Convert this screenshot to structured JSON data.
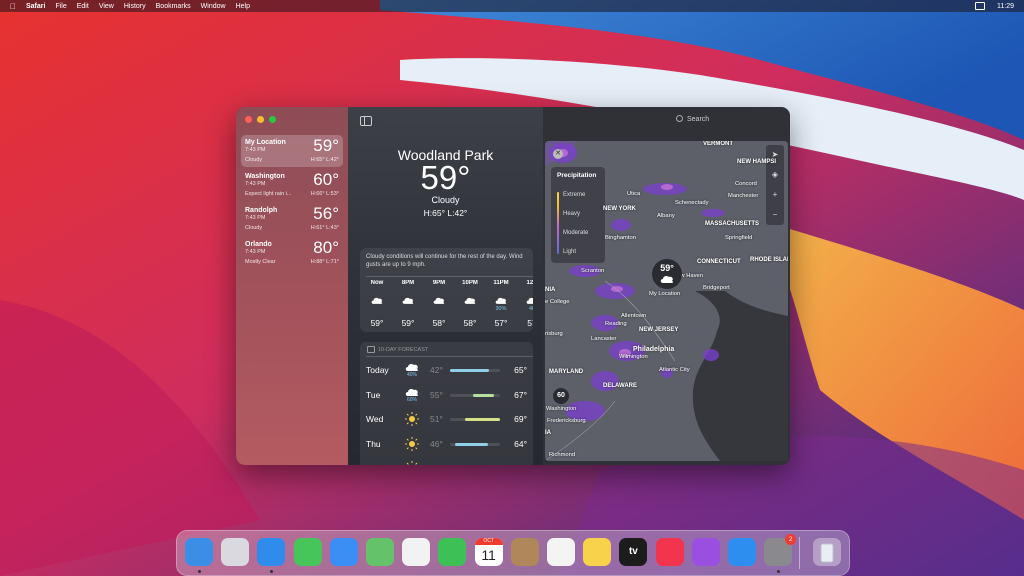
{
  "menubar": {
    "app": "Safari",
    "items": [
      "File",
      "Edit",
      "View",
      "History",
      "Bookmarks",
      "Window",
      "Help"
    ],
    "clock": "11:29"
  },
  "sidebar": {
    "locations": [
      {
        "name": "My Location",
        "time": "7:43 PM",
        "temp": "59°",
        "condition": "Cloudy",
        "hl": "H:65° L:42°",
        "selected": true
      },
      {
        "name": "Washington",
        "time": "7:43 PM",
        "temp": "60°",
        "condition": "Expect light rain i...",
        "hl": "H:66° L:53°",
        "selected": false
      },
      {
        "name": "Randolph",
        "time": "7:43 PM",
        "temp": "56°",
        "condition": "Cloudy",
        "hl": "H:61° L:43°",
        "selected": false
      },
      {
        "name": "Orlando",
        "time": "7:43 PM",
        "temp": "80°",
        "condition": "Mostly Clear",
        "hl": "H:88° L:71°",
        "selected": false
      }
    ]
  },
  "current": {
    "city": "Woodland Park",
    "temp": "59°",
    "condition": "Cloudy",
    "hl": "H:65°  L:42°"
  },
  "hourly": {
    "summary": "Cloudy conditions will continue for the rest of the day. Wind gusts are up to 9 mph.",
    "hours": [
      {
        "label": "Now",
        "icon": "cloud-icon",
        "pct": "",
        "temp": "59°"
      },
      {
        "label": "8PM",
        "icon": "cloud-icon",
        "pct": "",
        "temp": "59°"
      },
      {
        "label": "9PM",
        "icon": "cloud-icon",
        "pct": "",
        "temp": "58°"
      },
      {
        "label": "10PM",
        "icon": "cloud-icon",
        "pct": "",
        "temp": "58°"
      },
      {
        "label": "11PM",
        "icon": "cloud-rain-icon",
        "pct": "30%",
        "temp": "57°"
      },
      {
        "label": "12A",
        "icon": "cloud-rain-icon",
        "pct": "40",
        "temp": "57"
      }
    ]
  },
  "forecast": {
    "header": "10-DAY FORECAST",
    "days": [
      {
        "day": "Today",
        "icon": "cloud-rain-icon",
        "pct": "40%",
        "low": "42°",
        "high": "65°",
        "bar_start": 0.0,
        "bar_end": 0.78,
        "color": "#8fd0e8"
      },
      {
        "day": "Tue",
        "icon": "cloud-rain-icon",
        "pct": "60%",
        "low": "55°",
        "high": "67°",
        "bar_start": 0.45,
        "bar_end": 0.88,
        "color": "#b6e0a0"
      },
      {
        "day": "Wed",
        "icon": "sun-icon",
        "pct": "",
        "low": "51°",
        "high": "69°",
        "bar_start": 0.3,
        "bar_end": 1.0,
        "color": "#d6e08a"
      },
      {
        "day": "Thu",
        "icon": "sun-icon",
        "pct": "",
        "low": "46°",
        "high": "64°",
        "bar_start": 0.1,
        "bar_end": 0.75,
        "color": "#8fd0e8"
      },
      {
        "day": "Fri",
        "icon": "sun-icon",
        "pct": "",
        "low": "4°",
        "high": "69°",
        "bar_start": 0.1,
        "bar_end": 0.9,
        "color": "#8fd0e8"
      }
    ]
  },
  "map": {
    "search_placeholder": "Search",
    "legend": {
      "title": "Precipitation",
      "levels": [
        "Extreme",
        "Heavy",
        "Moderate",
        "Light"
      ]
    },
    "pin_main": {
      "temp": "59°",
      "label": "My Location"
    },
    "pin_small": {
      "temp": "60",
      "label": "Washington"
    },
    "labels": [
      {
        "text": "VERMONT",
        "state": true
      },
      {
        "text": "NEW HAMPSI",
        "state": true
      },
      {
        "text": "Concord",
        "state": false
      },
      {
        "text": "Manchester",
        "state": false
      },
      {
        "text": "Utica",
        "state": false
      },
      {
        "text": "Schenectady",
        "state": false
      },
      {
        "text": "NEW YORK",
        "state": true
      },
      {
        "text": "Albany",
        "state": false
      },
      {
        "text": "MASSACHUSETTS",
        "state": true
      },
      {
        "text": "Binghamton",
        "state": false
      },
      {
        "text": "Springfield",
        "state": false
      },
      {
        "text": "CONNECTICUT",
        "state": true
      },
      {
        "text": "RHODE ISLAND",
        "state": true
      },
      {
        "text": "Scranton",
        "state": false
      },
      {
        "text": "New Haven",
        "state": false
      },
      {
        "text": "Bridgeport",
        "state": false
      },
      {
        "text": "NIA",
        "state": true
      },
      {
        "text": "e College",
        "state": false
      },
      {
        "text": "Allentown",
        "state": false
      },
      {
        "text": "Reading",
        "state": false
      },
      {
        "text": "NEW JERSEY",
        "state": true
      },
      {
        "text": "risburg",
        "state": false
      },
      {
        "text": "Lancaster",
        "state": false
      },
      {
        "text": "Philadelphia",
        "state": false
      },
      {
        "text": "Wilmington",
        "state": false
      },
      {
        "text": "MARYLAND",
        "state": true
      },
      {
        "text": "Atlantic City",
        "state": false
      },
      {
        "text": "DELAWARE",
        "state": true
      },
      {
        "text": "Fredericksburg",
        "state": false
      },
      {
        "text": "Richmond",
        "state": false
      },
      {
        "text": "IA",
        "state": true
      }
    ],
    "controls": [
      "location-arrow-icon",
      "layers-icon",
      "+",
      "−"
    ]
  },
  "dock": {
    "apps": [
      {
        "name": "Finder",
        "color": "#3a8ee6"
      },
      {
        "name": "Launchpad",
        "color": "#d9d9df"
      },
      {
        "name": "Safari",
        "color": "#2f8bec"
      },
      {
        "name": "Messages",
        "color": "#45c55a"
      },
      {
        "name": "Mail",
        "color": "#3b8ef3"
      },
      {
        "name": "Maps",
        "color": "#64c26a"
      },
      {
        "name": "Photos",
        "color": "#f2f2f2"
      },
      {
        "name": "FaceTime",
        "color": "#3dc156"
      },
      {
        "name": "Calendar",
        "color": "#ffffff"
      },
      {
        "name": "Contacts",
        "color": "#b0875a"
      },
      {
        "name": "Reminders",
        "color": "#f4f4f4"
      },
      {
        "name": "Notes",
        "color": "#f7d24a"
      },
      {
        "name": "TV",
        "color": "#1c1c1c"
      },
      {
        "name": "Music",
        "color": "#f2344f"
      },
      {
        "name": "Podcasts",
        "color": "#9a4fe0"
      },
      {
        "name": "App Store",
        "color": "#2d8ef0"
      },
      {
        "name": "System Preferences",
        "color": "#8a8a8e"
      }
    ],
    "calendar_month": "OCT",
    "calendar_day": "11",
    "tv_label": "tv",
    "badge_count": "2",
    "trash_label": "Trash"
  }
}
